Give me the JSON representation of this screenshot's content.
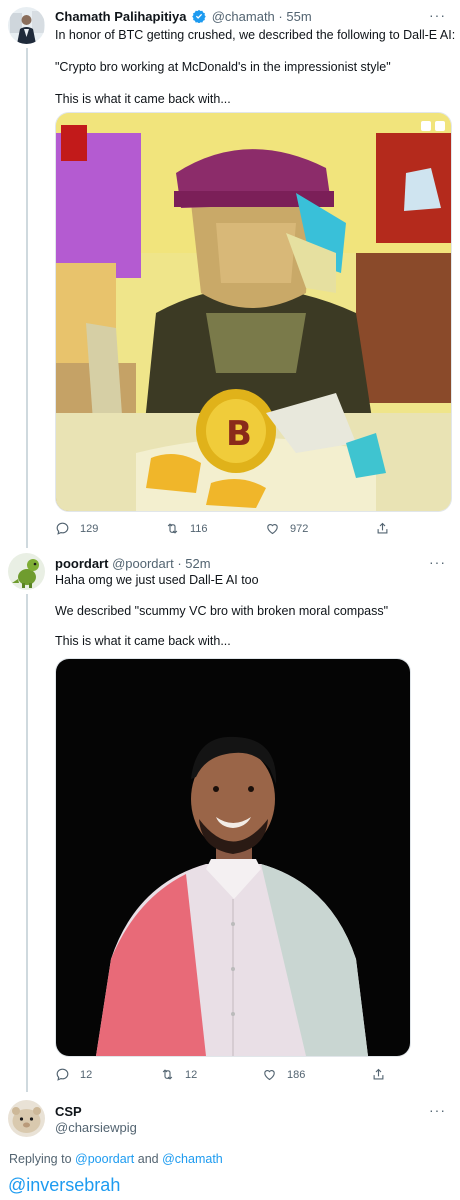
{
  "tweet1": {
    "name": "Chamath Palihapitiya",
    "handle": "@chamath",
    "time": "· 55m",
    "line1": "In honor of BTC getting crushed, we described the following to Dall-E AI:",
    "line2": "\"Crypto bro working at McDonald's in the impressionist style\"",
    "line3": "This is what it came back with...",
    "replies": "129",
    "retweets": "116",
    "likes": "972",
    "more": "···"
  },
  "tweet2": {
    "name": "poordart",
    "handle": "@poordart",
    "time": "· 52m",
    "line1": "Haha omg we just used Dall-E AI too",
    "line2": "We described \"scummy VC bro with broken moral compass\"",
    "line3": "This is what it came back with...",
    "replies": "12",
    "retweets": "12",
    "likes": "186",
    "more": "···"
  },
  "tweet3": {
    "name": "CSP",
    "handle": "@charsiewpig",
    "more": "···",
    "replying_prefix": "Replying to",
    "replying_to_1": "@poordart",
    "replying_and": "and",
    "replying_to_2": "@chamath",
    "body_mention": "@inversebrah"
  },
  "colors": {
    "accent": "#1d9bf0",
    "muted": "#536471"
  }
}
